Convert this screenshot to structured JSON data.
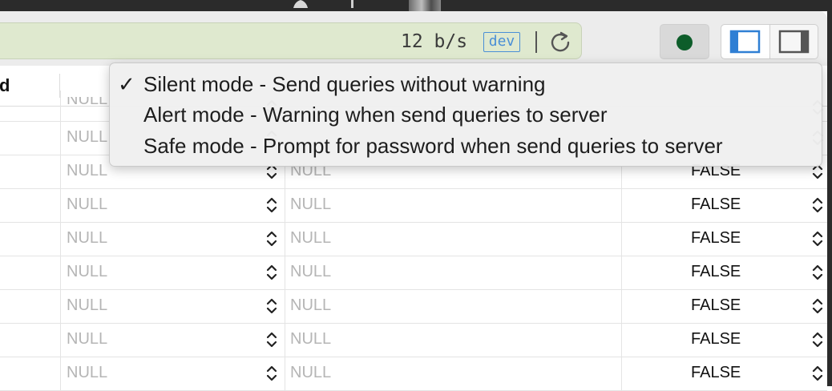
{
  "toolbar": {
    "transfer_rate": "12 b/s",
    "env_badge": "dev"
  },
  "table": {
    "partial_column_header": "d",
    "rows": [
      {
        "col1": "NULL",
        "col2": "",
        "col3": "",
        "partial": true
      },
      {
        "col1": "NULL",
        "col2": "",
        "col3": ""
      },
      {
        "col1": "NULL",
        "col2": "NULL",
        "col3": "FALSE"
      },
      {
        "col1": "NULL",
        "col2": "NULL",
        "col3": "FALSE"
      },
      {
        "col1": "NULL",
        "col2": "NULL",
        "col3": "FALSE"
      },
      {
        "col1": "NULL",
        "col2": "NULL",
        "col3": "FALSE"
      },
      {
        "col1": "NULL",
        "col2": "NULL",
        "col3": "FALSE"
      },
      {
        "col1": "NULL",
        "col2": "NULL",
        "col3": "FALSE"
      },
      {
        "col1": "NULL",
        "col2": "NULL",
        "col3": "FALSE"
      }
    ]
  },
  "mode_menu": {
    "check_glyph": "✓",
    "items": [
      {
        "label": "Silent mode - Send queries without warning",
        "checked": true
      },
      {
        "label": "Alert mode - Warning when send queries to server",
        "checked": false
      },
      {
        "label": "Safe mode - Prompt for password when send queries to server",
        "checked": false
      }
    ]
  },
  "colors": {
    "status_field_bg": "#dfe9cf",
    "env_badge": "#4a8fd6",
    "record_dot": "#0d5d2a",
    "null_text": "#b5b5b5"
  }
}
